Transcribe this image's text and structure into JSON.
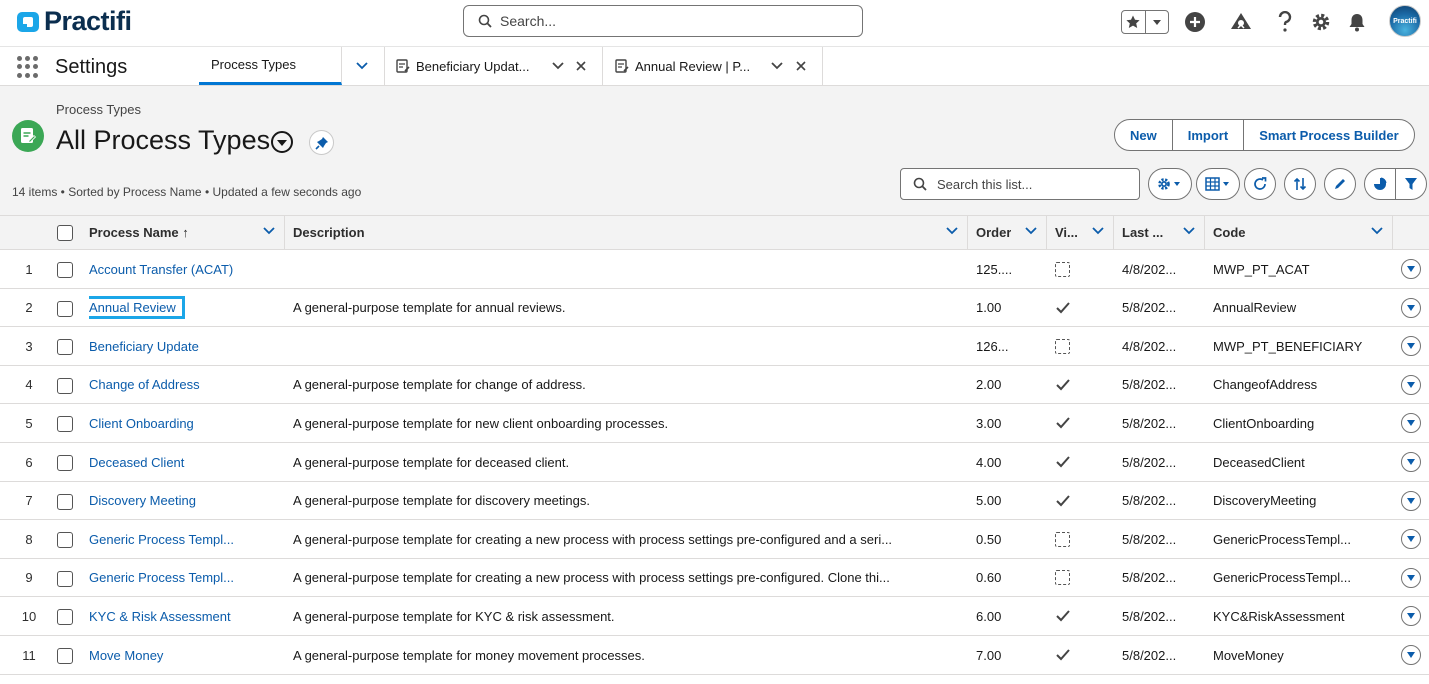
{
  "header": {
    "brand": "Practifi",
    "search_placeholder": "Search...",
    "avatar_text": "Practifi"
  },
  "nav": {
    "app_name": "Settings",
    "tabs": [
      {
        "label": "Process Types"
      },
      {
        "label": "Beneficiary Updat..."
      },
      {
        "label": "Annual Review | P..."
      }
    ]
  },
  "page": {
    "breadcrumb": "Process Types",
    "title": "All Process Types",
    "meta": "14 items • Sorted by Process Name • Updated a few seconds ago",
    "buttons": {
      "new": "New",
      "import": "Import",
      "smart": "Smart Process Builder"
    },
    "list_search_placeholder": "Search this list..."
  },
  "table": {
    "columns": {
      "name": "Process Name ↑",
      "description": "Description",
      "order": "Order",
      "visible": "Vi...",
      "last": "Last ...",
      "code": "Code"
    },
    "rows": [
      {
        "n": "1",
        "name": "Account Transfer (ACAT)",
        "description": "",
        "order": "125....",
        "visible": false,
        "last": "4/8/202...",
        "code": "MWP_PT_ACAT"
      },
      {
        "n": "2",
        "name": "Annual Review",
        "description": "A general-purpose template for annual reviews.",
        "order": "1.00",
        "visible": true,
        "last": "5/8/202...",
        "code": "AnnualReview",
        "selected": true
      },
      {
        "n": "3",
        "name": "Beneficiary Update",
        "description": "",
        "order": "126...",
        "visible": false,
        "last": "4/8/202...",
        "code": "MWP_PT_BENEFICIARY"
      },
      {
        "n": "4",
        "name": "Change of Address",
        "description": "A general-purpose template for change of address.",
        "order": "2.00",
        "visible": true,
        "last": "5/8/202...",
        "code": "ChangeofAddress"
      },
      {
        "n": "5",
        "name": "Client Onboarding",
        "description": "A general-purpose template for new client onboarding processes.",
        "order": "3.00",
        "visible": true,
        "last": "5/8/202...",
        "code": "ClientOnboarding"
      },
      {
        "n": "6",
        "name": "Deceased Client",
        "description": "A general-purpose template for deceased client.",
        "order": "4.00",
        "visible": true,
        "last": "5/8/202...",
        "code": "DeceasedClient"
      },
      {
        "n": "7",
        "name": "Discovery Meeting",
        "description": "A general-purpose template for discovery meetings.",
        "order": "5.00",
        "visible": true,
        "last": "5/8/202...",
        "code": "DiscoveryMeeting"
      },
      {
        "n": "8",
        "name": "Generic Process Templ...",
        "description": "A general-purpose template for creating a new process with process settings pre-configured and a seri...",
        "order": "0.50",
        "visible": false,
        "last": "5/8/202...",
        "code": "GenericProcessTempl..."
      },
      {
        "n": "9",
        "name": "Generic Process Templ...",
        "description": "A general-purpose template for creating a new process with process settings pre-configured. Clone thi...",
        "order": "0.60",
        "visible": false,
        "last": "5/8/202...",
        "code": "GenericProcessTempl..."
      },
      {
        "n": "10",
        "name": "KYC & Risk Assessment",
        "description": "A general-purpose template for KYC & risk assessment.",
        "order": "6.00",
        "visible": true,
        "last": "5/8/202...",
        "code": "KYC&RiskAssessment"
      },
      {
        "n": "11",
        "name": "Move Money",
        "description": "A general-purpose template for money movement processes.",
        "order": "7.00",
        "visible": true,
        "last": "5/8/202...",
        "code": "MoveMoney"
      }
    ]
  }
}
